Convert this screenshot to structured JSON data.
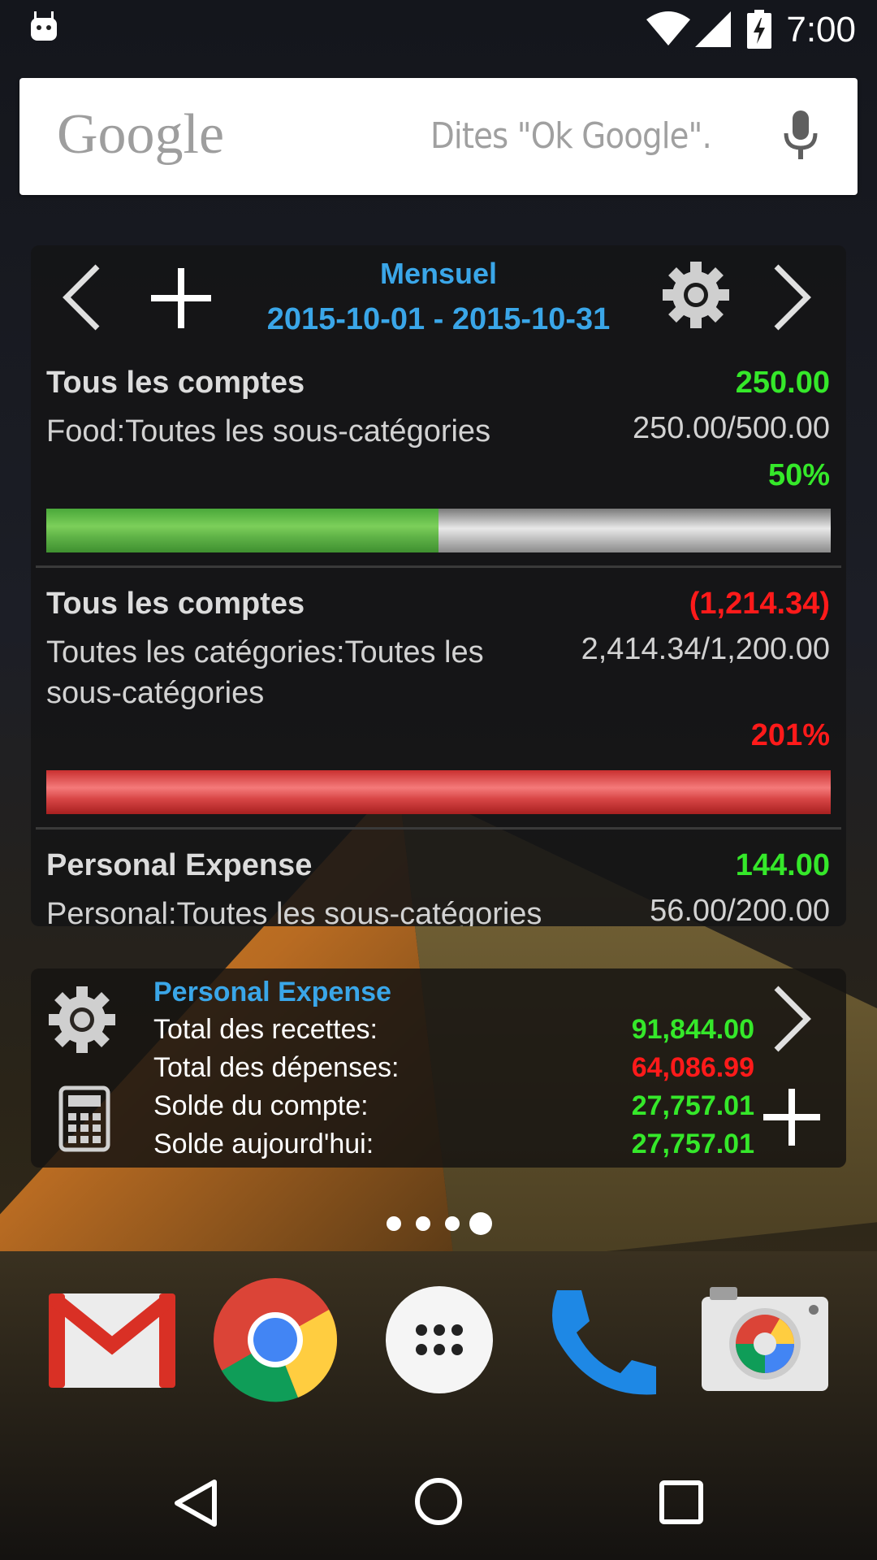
{
  "status_bar": {
    "time": "7:00"
  },
  "search": {
    "brand": "Google",
    "hint": "Dites \"Ok Google\"."
  },
  "budget_widget": {
    "period_label": "Mensuel",
    "period_range": "2015-10-01 - 2015-10-31",
    "items": [
      {
        "account": "Tous les comptes",
        "amount": "250.00",
        "amount_color": "#35e82a",
        "category": "Food:Toutes les sous-catégories",
        "ratio": "250.00/500.00",
        "percent": "50%",
        "progress": 0.5,
        "status": "ok"
      },
      {
        "account": "Tous les comptes",
        "amount": "(1,214.34)",
        "amount_color": "#ff1a1a",
        "category": "Toutes les catégories:Toutes les sous-catégories",
        "ratio": "2,414.34/1,200.00",
        "percent": "201%",
        "progress": 1.0,
        "status": "over"
      },
      {
        "account": "Personal Expense",
        "amount": "144.00",
        "amount_color": "#35e82a",
        "category": "Personal:Toutes les sous-catégories",
        "ratio": "56.00/200.00"
      }
    ]
  },
  "account_widget": {
    "title": "Personal Expense",
    "rows": [
      {
        "label": "Total des recettes:",
        "value": "91,844.00",
        "color": "#35e82a"
      },
      {
        "label": "Total des dépenses:",
        "value": "64,086.99",
        "color": "#ff1a1a"
      },
      {
        "label": "Solde du compte:",
        "value": "27,757.01",
        "color": "#35e82a"
      },
      {
        "label": "Solde aujourd'hui:",
        "value": "27,757.01",
        "color": "#35e82a"
      }
    ]
  },
  "home": {
    "page_count": 4,
    "current_page": 4
  },
  "dock": {
    "apps": [
      "gmail-icon",
      "chrome-icon",
      "app-drawer-icon",
      "phone-icon",
      "camera-icon"
    ]
  },
  "colors": {
    "accent_blue": "#3aa6e8",
    "positive": "#35e82a",
    "negative": "#ff1a1a"
  }
}
